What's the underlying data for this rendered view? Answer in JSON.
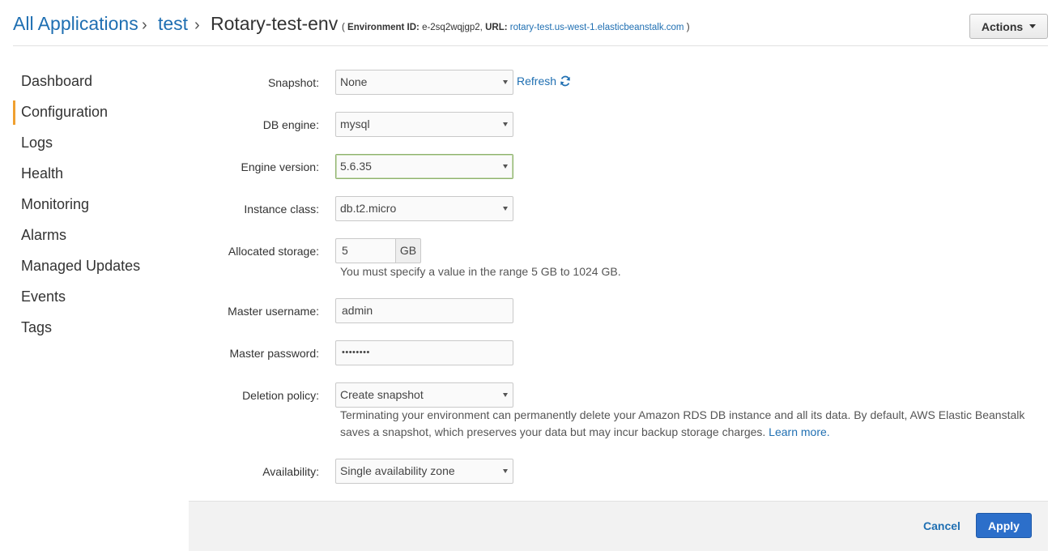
{
  "breadcrumb": {
    "application": "All Applications",
    "separator": "›",
    "app_name": "test",
    "environment": "Rotary-test-env",
    "meta_open": "(",
    "env_id_label": "Environment ID:",
    "env_id_value": "e-2sq2wqjgp2,",
    "url_label": "URL:",
    "url_value": "rotary-test.us-west-1.elasticbeanstalk.com",
    "meta_close": ")"
  },
  "actions_label": "Actions",
  "sidebar": {
    "items": [
      {
        "label": "Dashboard"
      },
      {
        "label": "Configuration"
      },
      {
        "label": "Logs"
      },
      {
        "label": "Health"
      },
      {
        "label": "Monitoring"
      },
      {
        "label": "Alarms"
      },
      {
        "label": "Managed Updates"
      },
      {
        "label": "Events"
      },
      {
        "label": "Tags"
      }
    ],
    "active": "Configuration"
  },
  "form": {
    "snapshot": {
      "label": "Snapshot:",
      "value": "None",
      "refresh_label": "Refresh"
    },
    "db_engine": {
      "label": "DB engine:",
      "value": "mysql"
    },
    "engine_version": {
      "label": "Engine version:",
      "value": "5.6.35"
    },
    "instance_class": {
      "label": "Instance class:",
      "value": "db.t2.micro"
    },
    "allocated_storage": {
      "label": "Allocated storage:",
      "value": "5",
      "unit": "GB",
      "help": "You must specify a value in the range 5 GB to 1024 GB."
    },
    "master_username": {
      "label": "Master username:",
      "value": "admin"
    },
    "master_password": {
      "label": "Master password:",
      "value": "••••••••"
    },
    "deletion_policy": {
      "label": "Deletion policy:",
      "value": "Create snapshot",
      "help_line1": "Terminating your environment can permanently delete your Amazon RDS DB instance and all its data. By default, AWS Elastic Beanstalk",
      "help_line2": "saves a snapshot, which preserves your data but may incur backup storage charges.",
      "learn_more": "Learn more."
    },
    "availability": {
      "label": "Availability:",
      "value": "Single availability zone"
    }
  },
  "footer": {
    "cancel_label": "Cancel",
    "apply_label": "Apply"
  },
  "colors": {
    "link": "#1f6fb2",
    "active_nav_marker": "#f0a030",
    "primary_button": "#2c6fca"
  }
}
